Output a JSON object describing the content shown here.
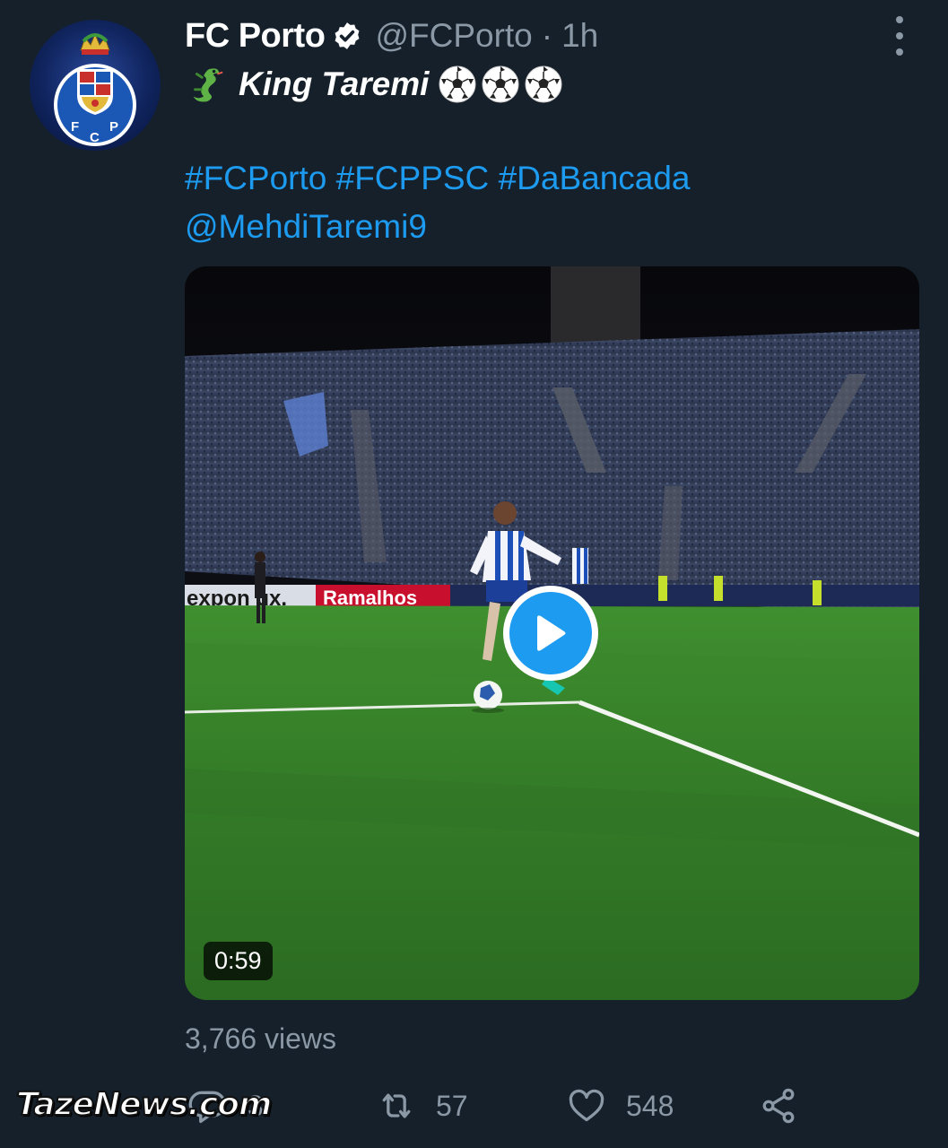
{
  "tweet": {
    "display_name": "FC Porto",
    "handle": "@FCPorto",
    "separator": "·",
    "timestamp": "1h",
    "title_text": "King Taremi",
    "hashtags": [
      "#FCPorto",
      "#FCPPSC",
      "#DaBancada"
    ],
    "mention": "@MehdiTaremi9",
    "icons": {
      "verified": "verified-badge-icon",
      "dragon": "dragon-emoji",
      "ball": "soccer-ball-emoji",
      "more": "more-options-icon"
    }
  },
  "media": {
    "type": "video",
    "duration": "0:59",
    "board_left": "expon ux.",
    "board_right": "Ramalhos"
  },
  "stats": {
    "views": "3,766 views"
  },
  "actions": {
    "reply_count": "3",
    "retweet_count": "57",
    "like_count": "548"
  },
  "watermark": "TazeNews.com",
  "colors": {
    "background": "#15202b",
    "accent": "#1d9bf0",
    "secondary_text": "#8b98a5"
  }
}
